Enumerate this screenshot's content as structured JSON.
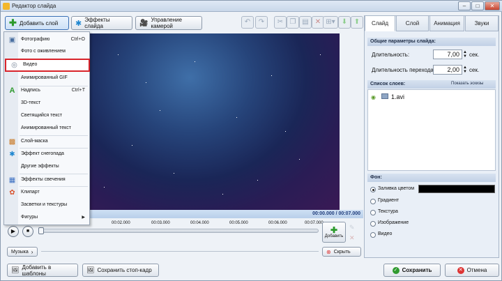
{
  "window": {
    "title": "Редактор слайда",
    "minimize": "–",
    "maximize": "□",
    "close": "✕"
  },
  "toolbar": {
    "add_layer": "Добавить слой",
    "slide_effects": "Эффекты слайда",
    "camera": "Управление камерой"
  },
  "menu": {
    "items": [
      {
        "label": "Фотографию",
        "shortcut": "Ctrl+O",
        "icon": "photo-icon"
      },
      {
        "label": "Фото с оживлением",
        "shortcut": "",
        "icon": ""
      },
      {
        "label": "Видео",
        "shortcut": "",
        "icon": "video-icon"
      },
      {
        "label": "Анимированный GIF",
        "shortcut": "",
        "icon": ""
      },
      {
        "label": "Надпись",
        "shortcut": "Ctrl+T",
        "icon": "text-icon"
      },
      {
        "label": "3D-текст",
        "shortcut": "",
        "icon": ""
      },
      {
        "label": "Светящийся текст",
        "shortcut": "",
        "icon": ""
      },
      {
        "label": "Анимированный текст",
        "shortcut": "",
        "icon": ""
      },
      {
        "label": "Слой-маска",
        "shortcut": "",
        "icon": "mask-icon"
      },
      {
        "label": "Эффект снегопада",
        "shortcut": "",
        "icon": "snowflake-icon"
      },
      {
        "label": "Другие эффекты",
        "shortcut": "",
        "icon": ""
      },
      {
        "label": "Эффекты свечения",
        "shortcut": "",
        "icon": "glow-icon"
      },
      {
        "label": "Клипарт",
        "shortcut": "",
        "icon": "clipart-icon"
      },
      {
        "label": "Засветки и текстуры",
        "shortcut": "",
        "icon": ""
      },
      {
        "label": "Фигуры",
        "shortcut": "",
        "icon": ""
      }
    ]
  },
  "timeline": {
    "time": "00:00.000 / 00:07.000",
    "ticks": [
      "00:02.000",
      "00:03.000",
      "00:04.000",
      "00:05.000",
      "00:06.000",
      "00:07.000"
    ],
    "add": "Добавить",
    "hide": "Скрыть",
    "music": "Музыка"
  },
  "tabs": [
    "Слайд",
    "Слой",
    "Анимация",
    "Звуки"
  ],
  "slide": {
    "general_header": "Общие параметры слайда:",
    "duration_label": "Длительность:",
    "duration_value": "7,00",
    "sec": "сек.",
    "transition_label": "Длительность перехода:",
    "transition_value": "2,00",
    "layers_header": "Список слоев:",
    "show_thumbs": "Показать эскизы",
    "layer_item": "1.avi",
    "bg_header": "Фон:",
    "bg_options": [
      "Заливка цветом",
      "Градиент",
      "Текстура",
      "Изображение",
      "Видео"
    ],
    "bg_color": "#000000"
  },
  "footer": {
    "templates": "Добавить в шаблоны",
    "save_frame": "Сохранить стоп-кадр",
    "save": "Сохранить",
    "cancel": "Отмена"
  }
}
